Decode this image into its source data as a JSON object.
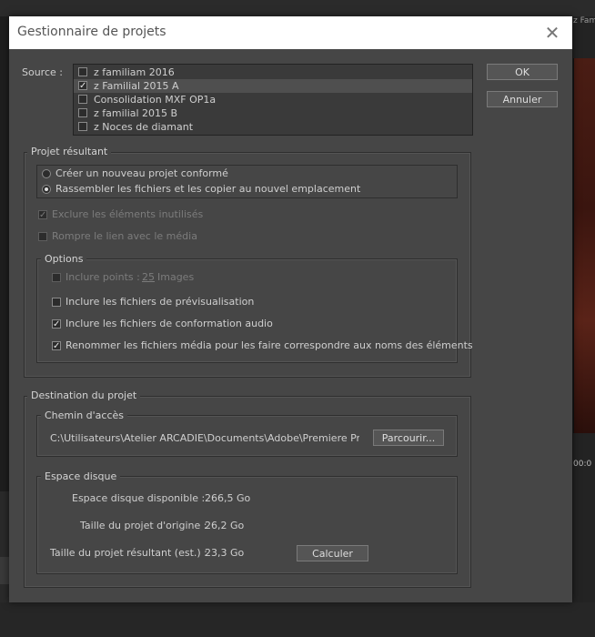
{
  "background": {
    "video_tab": "z Fami",
    "timecode": "00:0"
  },
  "dialog": {
    "title": "Gestionnaire de projets",
    "ok_label": "OK",
    "cancel_label": "Annuler"
  },
  "source": {
    "label": "Source :",
    "items": [
      {
        "label": "z familiam 2016",
        "checked": false
      },
      {
        "label": "z Familial 2015  A",
        "checked": true
      },
      {
        "label": "Consolidation  MXF OP1a",
        "checked": false
      },
      {
        "label": "z familial 2015 B",
        "checked": false
      },
      {
        "label": "z Noces de diamant",
        "checked": false
      }
    ]
  },
  "projet_resultant": {
    "legend": "Projet résultant",
    "radio_new": "Créer un nouveau projet conformé",
    "radio_collect": "Rassembler les fichiers et les copier au nouvel emplacement",
    "selected": "collect",
    "exclude_unused": "Exclure les éléments inutilisés",
    "break_link": "Rompre le lien avec le média",
    "options": {
      "legend": "Options",
      "include_handles_prefix": "Inclure points :",
      "include_handles_value": "25",
      "include_handles_suffix": "Images",
      "include_preview": "Inclure les fichiers de prévisualisation",
      "include_audio_conform": "Inclure les fichiers de conformation audio",
      "rename_media": "Renommer les fichiers média pour les faire correspondre aux noms des éléments"
    }
  },
  "destination": {
    "legend": "Destination du projet",
    "path_legend": "Chemin d'accès",
    "path_value": "C:\\Utilisateurs\\Atelier ARCADIE\\Documents\\Adobe\\Premiere Pro...",
    "browse_label": "Parcourir...",
    "disk_legend": "Espace disque",
    "available_label": "Espace disque disponible :",
    "available_value": "266,5 Go",
    "original_label": "Taille du projet d'origine :",
    "original_value": "26,2 Go",
    "result_label": "Taille du projet résultant (est.) :",
    "result_value": "23,3 Go",
    "calc_label": "Calculer"
  }
}
